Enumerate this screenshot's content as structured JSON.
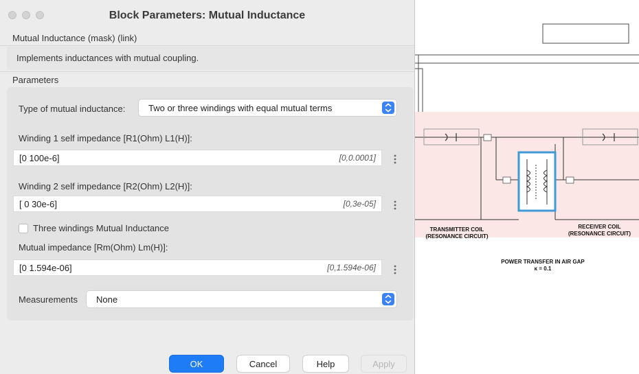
{
  "window": {
    "title": "Block Parameters: Mutual Inductance"
  },
  "block": {
    "header": "Mutual Inductance (mask) (link)",
    "description": "Implements inductances with mutual coupling."
  },
  "parameters": {
    "section_label": "Parameters",
    "type_label": "Type of mutual inductance:",
    "type_value": "Two or three windings with equal mutual terms",
    "winding1_label": "Winding 1 self impedance [R1(Ohm) L1(H)]:",
    "winding1_value": "[0 100e-6]",
    "winding1_hint": "[0,0.0001]",
    "winding2_label": "Winding 2 self impedance [R2(Ohm) L2(H)]:",
    "winding2_value": "[ 0 30e-6]",
    "winding2_hint": "[0,3e-05]",
    "three_windings_label": "Three windings Mutual Inductance",
    "three_windings_checked": false,
    "mutual_label": "Mutual impedance [Rm(Ohm) Lm(H)]:",
    "mutual_value": "[0 1.594e-06]",
    "mutual_hint": "[0,1.594e-06]",
    "measurements_label": "Measurements",
    "measurements_value": "None"
  },
  "buttons": {
    "ok": "OK",
    "cancel": "Cancel",
    "help": "Help",
    "apply": "Apply"
  },
  "model": {
    "transmitter_label_line1": "TRANSMITTER COIL",
    "transmitter_label_line2": "(RESONANCE CIRCUIT)",
    "receiver_label_line1": "RECEIVER COIL",
    "receiver_label_line2": "(RESONANCE CIRCUIT)",
    "caption_line1": "POWER TRANSFER IN AIR GAP",
    "caption_line2": "κ = 0.1"
  },
  "colors": {
    "accent": "#1e7cf7",
    "stepper": "#3b82f7",
    "circuit_fill": "#fbe7e5",
    "selected_block": "#3d9ad6"
  }
}
